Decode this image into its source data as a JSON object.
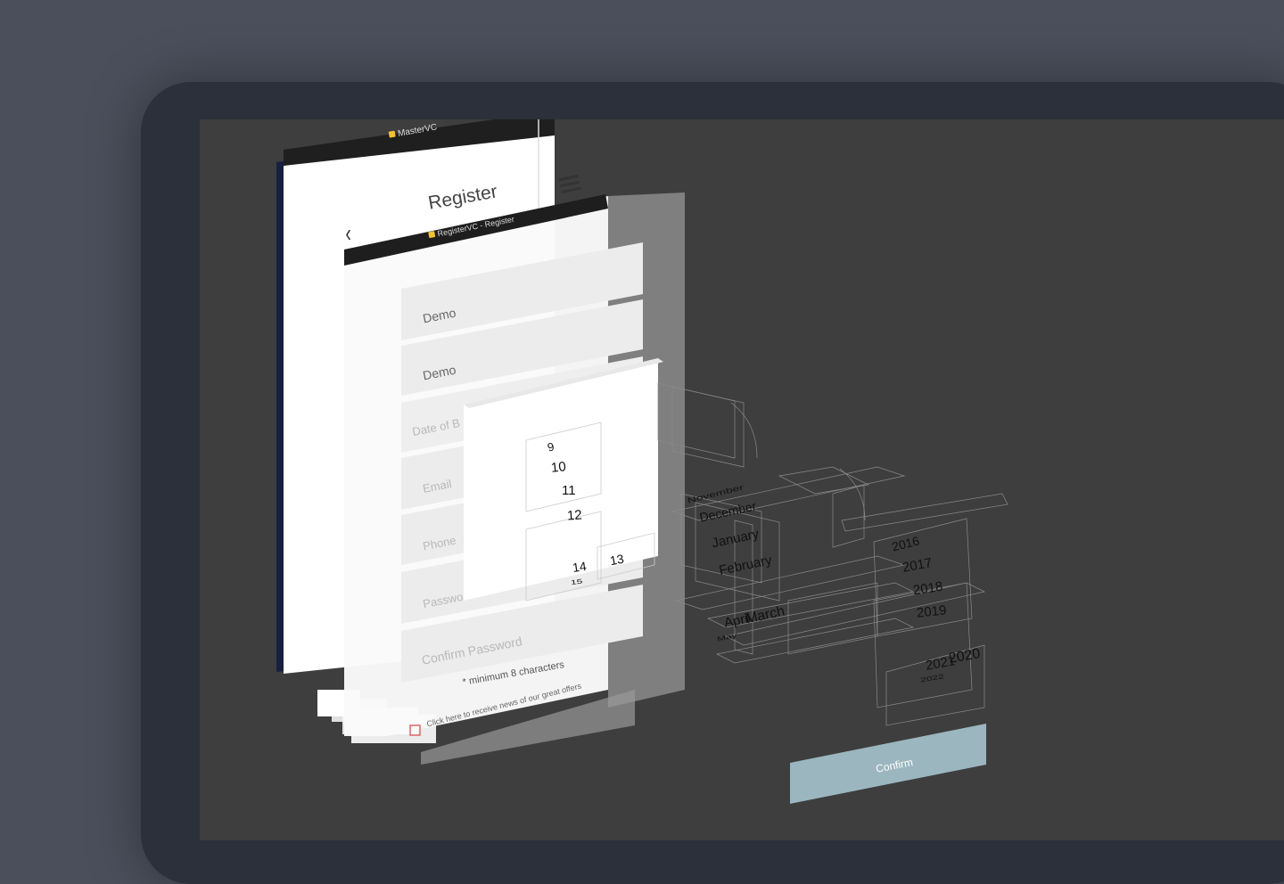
{
  "master_tag": "MasterVC",
  "register_tag": "RegisterVC - Register",
  "title": "Register",
  "fields": {
    "first_name_value": "Demo",
    "last_name_value": "Demo",
    "dob_placeholder": "Date of B",
    "email_placeholder": "Email",
    "phone_placeholder": "Phone",
    "password_placeholder": "Passwo",
    "confirm_password_placeholder": "Confirm Password"
  },
  "password_hint": "* minimum 8 characters",
  "checkbox_label": "Click here to receive news of our great offers",
  "picker": {
    "days": [
      "9",
      "10",
      "11",
      "12",
      "13",
      "14",
      "15"
    ],
    "months": [
      "November",
      "December",
      "January",
      "February",
      "March",
      "April",
      "May"
    ],
    "years": [
      "2016",
      "2017",
      "2018",
      "2019",
      "2020",
      "2021",
      "2022"
    ]
  },
  "confirm_label": "Confirm",
  "colors": {
    "background": "#4a4f5b",
    "frame": "#2b303a",
    "canvas": "#3e3e3e",
    "confirm_button": "#9bb6bf"
  }
}
